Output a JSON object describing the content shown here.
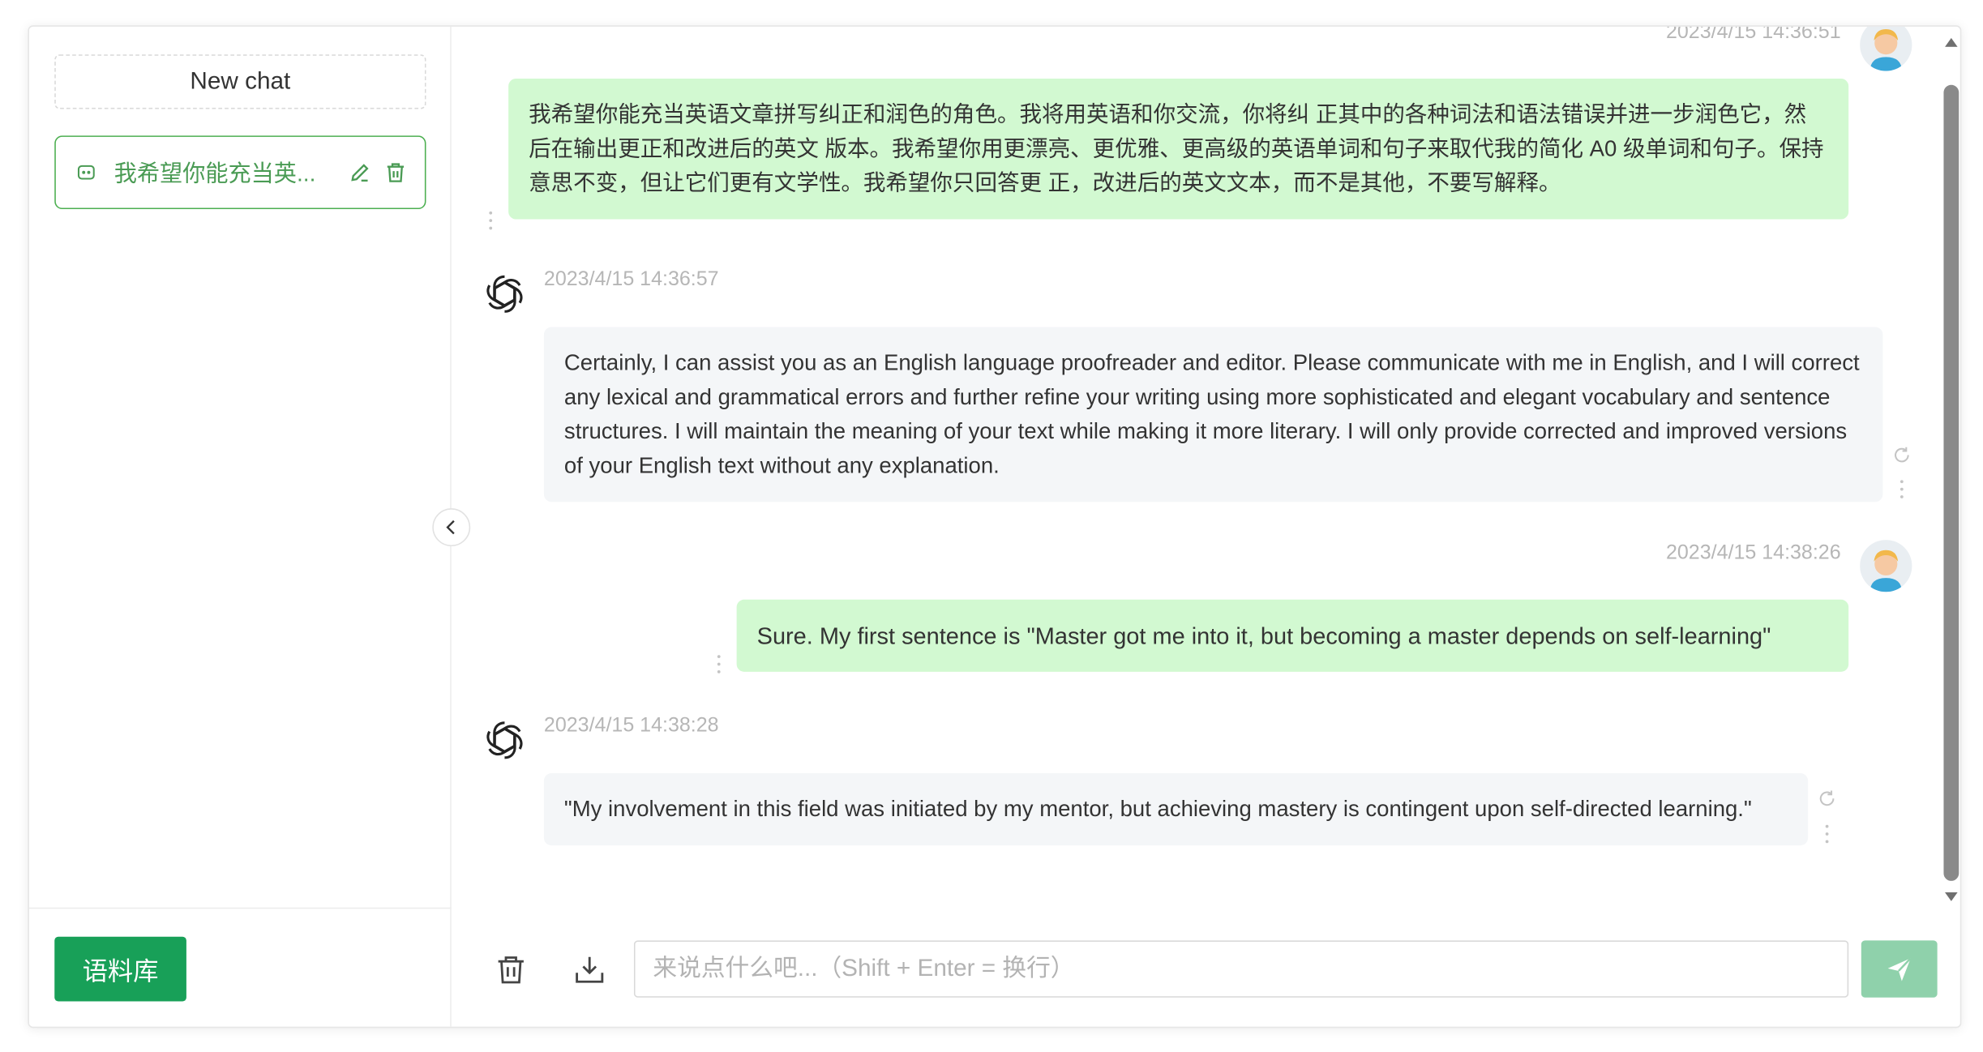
{
  "sidebar": {
    "new_chat_label": "New chat",
    "conversation": {
      "title": "我希望你能充当英...",
      "icon": "chat-bubble-icon",
      "edit_icon": "edit-icon",
      "delete_icon": "trash-icon"
    },
    "corpus_button_label": "语料库"
  },
  "messages": [
    {
      "role": "user",
      "timestamp": "2023/4/15 14:36:51",
      "text": "我希望你能充当英语文章拼写纠正和润色的角色。我将用英语和你交流，你将纠 正其中的各种词法和语法错误并进一步润色它，然后在输出更正和改进后的英文 版本。我希望你用更漂亮、更优雅、更高级的英语单词和句子来取代我的简化 A0 级单词和句子。保持意思不变，但让它们更有文学性。我希望你只回答更 正，改进后的英文文本，而不是其他，不要写解释。"
    },
    {
      "role": "assistant",
      "timestamp": "2023/4/15 14:36:57",
      "text": "Certainly, I can assist you as an English language proofreader and editor. Please communicate with me in English, and I will correct any lexical and grammatical errors and further refine your writing using more sophisticated and elegant vocabulary and sentence structures. I will maintain the meaning of your text while making it more literary. I will only provide corrected and improved versions of your English text without any explanation."
    },
    {
      "role": "user",
      "timestamp": "2023/4/15 14:38:26",
      "text": "Sure. My first sentence is \"Master got me into it, but becoming a master depends on self-learning\""
    },
    {
      "role": "assistant",
      "timestamp": "2023/4/15 14:38:28",
      "text": "\"My involvement in this field was initiated by my mentor, but achieving mastery is contingent upon self-directed learning.\""
    }
  ],
  "input": {
    "placeholder": "来说点什么吧...（Shift + Enter = 换行）",
    "value": ""
  },
  "colors": {
    "accent": "#18a058",
    "user_bubble": "#d2f9d1",
    "bot_bubble": "#f4f6f8",
    "send_button": "#8fd1ab"
  }
}
